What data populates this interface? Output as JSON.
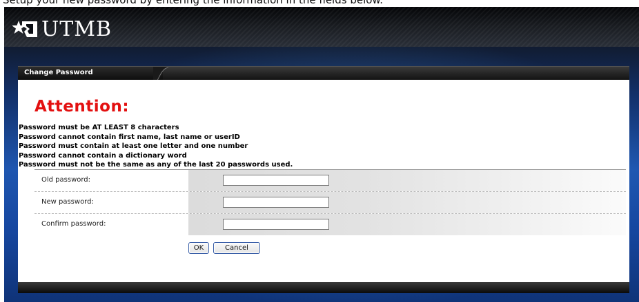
{
  "top_caption": "Setup your new password by entering the information in the fields below.",
  "brand": {
    "name": "UTMB",
    "logo_icon": "star-flag-icon"
  },
  "tab": {
    "title": "Change Password"
  },
  "attention": {
    "heading": "Attention:"
  },
  "rules": [
    "Password must be AT LEAST 8 characters",
    "Password cannot contain first name, last name or userID",
    "Password must contain at least one letter and one number",
    "Password cannot contain a dictionary word",
    "Password must not be the same as any of the last 20 passwords used."
  ],
  "form": {
    "old_password": {
      "label": "Old password:",
      "value": ""
    },
    "new_password": {
      "label": "New password:",
      "value": ""
    },
    "confirm_password": {
      "label": "Confirm password:",
      "value": ""
    }
  },
  "buttons": {
    "ok": "OK",
    "cancel": "Cancel"
  },
  "colors": {
    "attention": "#e31010",
    "frame_blue": "#1e56b0",
    "header_dark": "#1a1d22"
  }
}
